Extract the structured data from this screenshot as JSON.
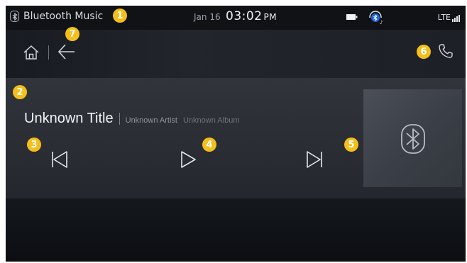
{
  "status_bar": {
    "source_icon": "bluetooth-icon",
    "source_label": "Bluetooth Music",
    "date": "Jan 16",
    "time": "03:02",
    "ampm": "PM",
    "battery_icon": "battery-icon",
    "headset_icon": "bluetooth-headset-icon",
    "network": "LTE",
    "signal_icon": "signal-bars-icon"
  },
  "nav": {
    "home_icon": "home-icon",
    "back_icon": "back-arrow-icon",
    "phone_icon": "phone-icon"
  },
  "track": {
    "title": "Unknown Title",
    "artist": "Unknown Artist",
    "album": "Unknown Album"
  },
  "controls": {
    "prev_icon": "skip-previous-icon",
    "play_icon": "play-icon",
    "next_icon": "skip-next-icon"
  },
  "album_art": {
    "icon": "bluetooth-icon"
  },
  "markers": [
    "1",
    "2",
    "3",
    "4",
    "5",
    "6",
    "7"
  ],
  "colors": {
    "marker": "#f5bf1a",
    "background": "#0d0f13",
    "player": "#2c2f35",
    "text": "#f2f3f5"
  }
}
